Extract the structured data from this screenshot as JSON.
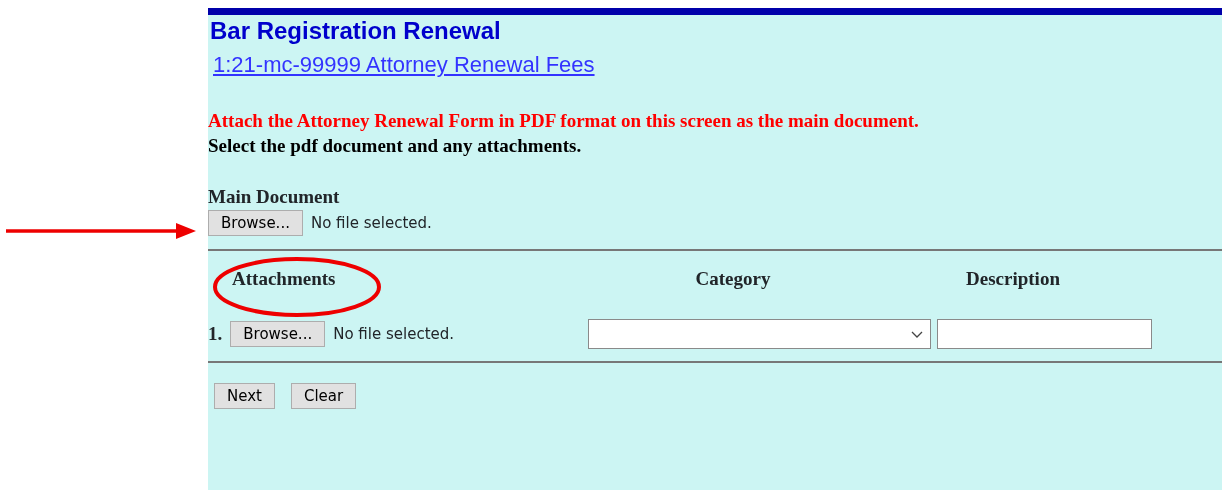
{
  "header": {
    "title": "Bar Registration Renewal",
    "case_link": "1:21-mc-99999 Attorney Renewal Fees"
  },
  "instructions": [
    {
      "kind": "warning",
      "text": "Attach the Attorney Renewal Form in PDF format on this screen as the main document."
    },
    {
      "kind": "note",
      "text": "Select the pdf document and any attachments."
    }
  ],
  "main_document": {
    "label": "Main Document",
    "button": "Browse...",
    "file_status": "No file selected."
  },
  "attachments": {
    "columns": [
      "Attachments",
      "Category",
      "Description"
    ],
    "rows": [
      {
        "number": "1.",
        "button": "Browse...",
        "file_status": "No file selected."
      }
    ]
  },
  "buttons": [
    "Next",
    "Clear"
  ],
  "annotations": {
    "pointer_arrow": true,
    "highlight_ellipse": true
  }
}
